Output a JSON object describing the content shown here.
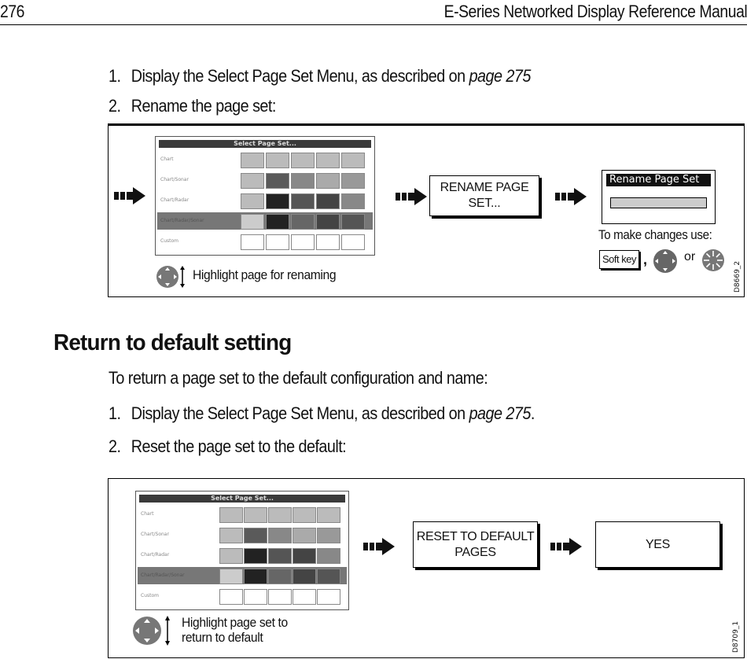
{
  "header": {
    "page_number": "276",
    "manual_title": "E-Series Networked Display Reference Manual"
  },
  "rename_section": {
    "steps": [
      {
        "num": "1.",
        "text": "Display the Select Page Set Menu, as described on ",
        "link": "page 275",
        "suffix": ""
      },
      {
        "num": "2.",
        "text": "Rename the page set:",
        "link": "",
        "suffix": ""
      }
    ],
    "diagram": {
      "screen": {
        "title": "Select Page Set...",
        "rows": [
          "Chart",
          "Chart/Sonar",
          "Chart/Radar",
          "Chart/Radar/Sonar",
          "Custom"
        ],
        "highlighted_row": "Chart/Radar/Sonar"
      },
      "softkey_button": "RENAME PAGE SET...",
      "dialog_title": "Rename Page Set",
      "changes_text": "To make changes use:",
      "soft_key_label": "Soft key",
      "comma": ",",
      "or_text": "or",
      "caption": "Highlight page for renaming",
      "figure_code": "D8669_2"
    }
  },
  "default_section": {
    "heading": "Return to default setting",
    "intro": "To return a page set to the default configuration and name:",
    "steps": [
      {
        "num": "1.",
        "text": "Display the Select Page Set Menu, as described on ",
        "link": "page 275",
        "suffix": "."
      },
      {
        "num": "2.",
        "text": "Reset the page set to the default:",
        "link": "",
        "suffix": ""
      }
    ],
    "diagram": {
      "screen": {
        "title": "Select Page Set...",
        "rows": [
          "Chart",
          "Chart/Sonar",
          "Chart/Radar",
          "Chart/Radar/Sonar",
          "Custom"
        ],
        "highlighted_row": "Chart/Radar/Sonar"
      },
      "softkey_button": "RESET TO DEFAULT PAGES",
      "confirm_button": "YES",
      "caption_line1": "Highlight page set to",
      "caption_line2": "return to default",
      "figure_code": "D8709_1"
    }
  }
}
